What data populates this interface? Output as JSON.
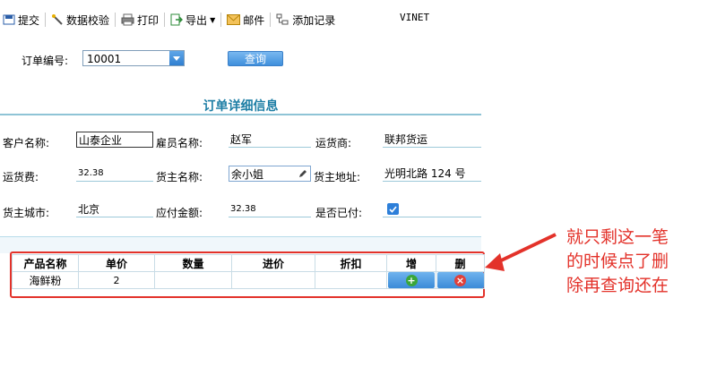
{
  "toolbar": {
    "submit": "提交",
    "validate": "数据校验",
    "print": "打印",
    "export": "导出",
    "mail": "邮件",
    "add_record": "添加记录",
    "title": "VINET"
  },
  "search": {
    "order_label": "订单编号:",
    "order_value": "10001",
    "query_button": "查询"
  },
  "section": {
    "title": "订单详细信息"
  },
  "form": {
    "customer_label": "客户名称:",
    "customer_value": "山泰企业",
    "employee_label": "雇员名称:",
    "employee_value": "赵军",
    "shipper_label": "运货商:",
    "shipper_value": "联邦货运",
    "freight_label": "运货费:",
    "freight_value": "32.38",
    "consignee_label": "货主名称:",
    "consignee_value": "余小姐",
    "address_label": "货主地址:",
    "address_value": "光明北路 124 号",
    "city_label": "货主城市:",
    "city_value": "北京",
    "amount_label": "应付金额:",
    "amount_value": "32.38",
    "paid_label": "是否已付:",
    "paid_checked": true
  },
  "grid": {
    "headers": [
      "产品名称",
      "单价",
      "数量",
      "进价",
      "折扣",
      "增",
      "删"
    ],
    "rows": [
      {
        "product": "海鲜粉",
        "price": "2",
        "qty": "",
        "cost": "",
        "discount": ""
      }
    ]
  },
  "annotation": {
    "line1": "就只剩这一笔",
    "line2": "的时候点了删",
    "line3": "除再查询还在",
    "color": "#e3322a"
  }
}
